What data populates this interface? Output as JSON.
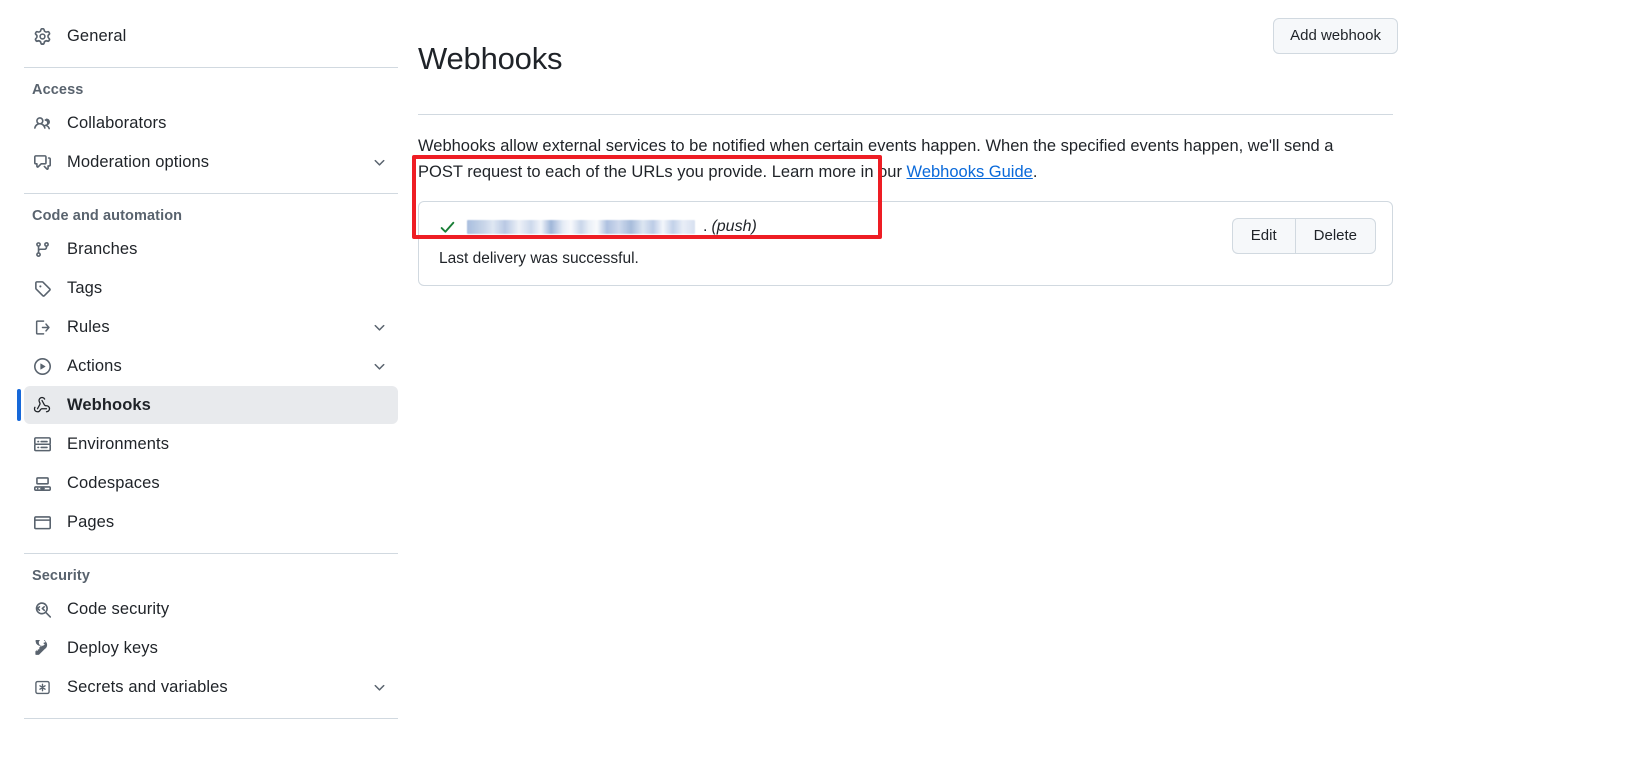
{
  "sidebar": {
    "top_items": [
      {
        "label": "General",
        "icon": "gear-icon",
        "name": "general",
        "chevron": false
      }
    ],
    "sections": [
      {
        "header": "Access",
        "items": [
          {
            "label": "Collaborators",
            "icon": "people-icon",
            "name": "collaborators",
            "chevron": false
          },
          {
            "label": "Moderation options",
            "icon": "comment-discussion-icon",
            "name": "moderation-options",
            "chevron": true
          }
        ]
      },
      {
        "header": "Code and automation",
        "items": [
          {
            "label": "Branches",
            "icon": "git-branch-icon",
            "name": "branches",
            "chevron": false
          },
          {
            "label": "Tags",
            "icon": "tag-icon",
            "name": "tags",
            "chevron": false
          },
          {
            "label": "Rules",
            "icon": "rules-icon",
            "name": "rules",
            "chevron": true
          },
          {
            "label": "Actions",
            "icon": "play-circle-icon",
            "name": "actions",
            "chevron": true
          },
          {
            "label": "Webhooks",
            "icon": "webhook-icon",
            "name": "webhooks",
            "chevron": false,
            "selected": true
          },
          {
            "label": "Environments",
            "icon": "server-icon",
            "name": "environments",
            "chevron": false
          },
          {
            "label": "Codespaces",
            "icon": "codespaces-icon",
            "name": "codespaces",
            "chevron": false
          },
          {
            "label": "Pages",
            "icon": "browser-icon",
            "name": "pages",
            "chevron": false
          }
        ]
      },
      {
        "header": "Security",
        "items": [
          {
            "label": "Code security",
            "icon": "code-search-icon",
            "name": "code-security",
            "chevron": false
          },
          {
            "label": "Deploy keys",
            "icon": "key-icon",
            "name": "deploy-keys",
            "chevron": false
          },
          {
            "label": "Secrets and variables",
            "icon": "asterisk-key-icon",
            "name": "secrets-and-variables",
            "chevron": true
          }
        ]
      }
    ]
  },
  "main": {
    "title": "Webhooks",
    "add_button": "Add webhook",
    "description": {
      "before_link": "Webhooks allow external services to be notified when certain events happen. When the specified events happen, we'll send a POST request to each of the URLs you provide. Learn more in our ",
      "link_text": "Webhooks Guide",
      "after_link": "."
    },
    "webhooks": [
      {
        "status_icon": "check-icon",
        "url": "",
        "url_redacted": true,
        "separator": ".",
        "events": "(push)",
        "delivery_status": "Last delivery was successful.",
        "edit_label": "Edit",
        "delete_label": "Delete"
      }
    ]
  },
  "annotation": {
    "type": "highlight-rectangle",
    "color": "#ee1d24"
  }
}
